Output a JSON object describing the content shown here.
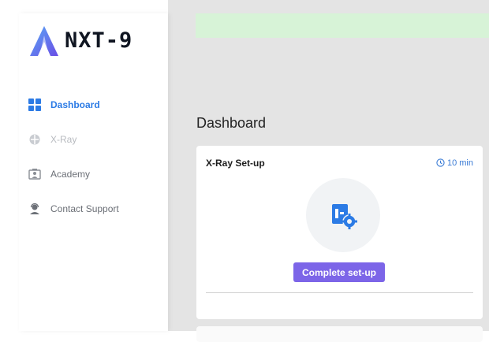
{
  "app": {
    "logo_text": "NXT-9",
    "brand_color": "#2c7be5"
  },
  "sidebar": {
    "items": [
      {
        "label": "Dashboard",
        "icon": "dashboard-grid-icon",
        "state": "active"
      },
      {
        "label": "X-Ray",
        "icon": "xray-icon",
        "state": "disabled"
      },
      {
        "label": "Academy",
        "icon": "academy-icon",
        "state": "normal"
      },
      {
        "label": "Contact Support",
        "icon": "support-agent-icon",
        "state": "normal"
      }
    ]
  },
  "main": {
    "banner_color": "#d7f3d7",
    "page_title": "Dashboard",
    "card": {
      "title": "X-Ray Set-up",
      "time": "10 min",
      "time_icon": "clock-icon",
      "illustration_icon": "setup-gear-icon",
      "button_label": "Complete set-up",
      "button_color": "#7c65e8"
    }
  }
}
